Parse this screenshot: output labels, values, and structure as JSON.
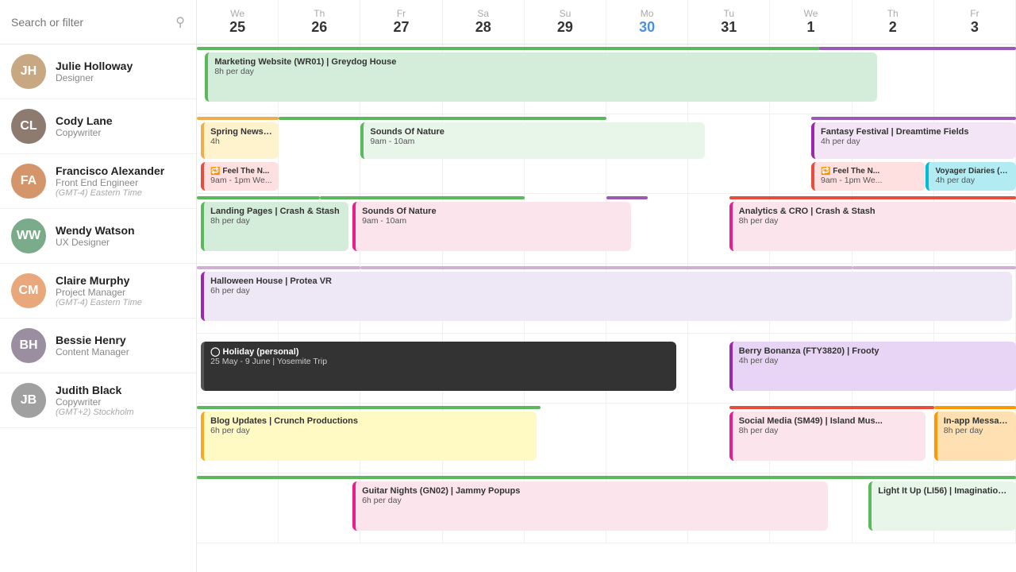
{
  "search": {
    "placeholder": "Search or filter"
  },
  "days": [
    {
      "name": "We",
      "num": "25"
    },
    {
      "name": "Th",
      "num": "26"
    },
    {
      "name": "Fr",
      "num": "27"
    },
    {
      "name": "Sa",
      "num": "28"
    },
    {
      "name": "Su",
      "num": "29"
    },
    {
      "name": "Mo",
      "num": "30",
      "today": true
    },
    {
      "name": "Tu",
      "num": "31"
    },
    {
      "name": "We",
      "num": "1"
    },
    {
      "name": "Th",
      "num": "2"
    },
    {
      "name": "Fr",
      "num": "3"
    }
  ],
  "people": [
    {
      "id": "julie",
      "name": "Julie Holloway",
      "role": "Designer",
      "color": "#c8a882",
      "initials": "JH"
    },
    {
      "id": "cody",
      "name": "Cody Lane",
      "role": "Copywriter",
      "color": "#8c7b6e",
      "initials": "CL"
    },
    {
      "id": "francisco",
      "name": "Francisco Alexander",
      "role": "Front End Engineer",
      "timezone": "(GMT-4) Eastern Time",
      "color": "#d4956a",
      "initials": "FA"
    },
    {
      "id": "wendy",
      "name": "Wendy Watson",
      "role": "UX Designer",
      "color": "#7aab8a",
      "initials": "WW"
    },
    {
      "id": "claire",
      "name": "Claire Murphy",
      "role": "Project Manager",
      "timezone": "(GMT-4) Eastern Time",
      "color": "#e8a87c",
      "initials": "CM"
    },
    {
      "id": "bessie",
      "name": "Bessie Henry",
      "role": "Content Manager",
      "color": "#9b8ea0",
      "initials": "BH"
    },
    {
      "id": "judith",
      "name": "Judith Black",
      "role": "Copywriter",
      "timezone": "(GMT+2) Stockholm",
      "color": "#a0a0a0",
      "initials": "JB"
    }
  ],
  "colors": {
    "green_light": "#d4edda",
    "green_ind": "#5cb85c",
    "yellow": "#fff3cd",
    "yellow_ind": "#f0ad4e",
    "pink": "#fce4ec",
    "pink_ind": "#e91e8c",
    "blue": "#e3f2fd",
    "blue_ind": "#2196f3",
    "cyan": "#b2ebf2",
    "cyan_ind": "#00bcd4",
    "purple": "#e8d5f5",
    "purple_ind": "#9c27b0",
    "orange": "#ffe0b2",
    "orange_ind": "#ff9800",
    "dark": "#333",
    "teal": "#80cbc4"
  }
}
